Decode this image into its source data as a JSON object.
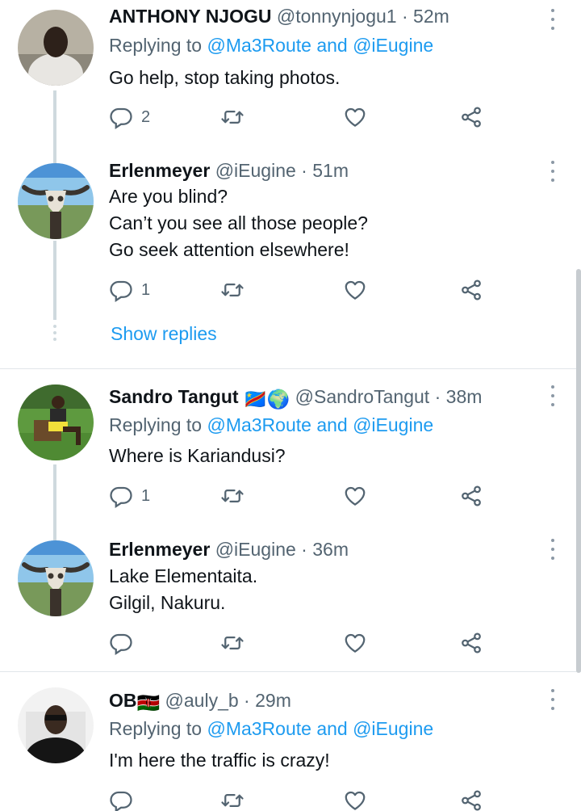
{
  "tweets": [
    {
      "name": "ANTHONY NJOGU",
      "flags": "",
      "handle": "@tonnynjogu1",
      "time": "52m",
      "replying_prefix": "Replying to",
      "replying_mentions": "@Ma3Route and @iEugine",
      "lines": [
        "Go help, stop taking photos."
      ],
      "reply_count": "2"
    },
    {
      "name": "Erlenmeyer",
      "flags": "",
      "handle": "@iEugine",
      "time": "51m",
      "lines": [
        "Are you blind?",
        "Can’t you see all those people?",
        "Go seek attention elsewhere!"
      ],
      "reply_count": "1"
    },
    {
      "name": "Sandro Tangut",
      "flags": "🇨🇩🌍",
      "handle": "@SandroTangut",
      "time": "38m",
      "replying_prefix": "Replying to",
      "replying_mentions": "@Ma3Route and @iEugine",
      "lines": [
        "Where is Kariandusi?"
      ],
      "reply_count": "1"
    },
    {
      "name": "Erlenmeyer",
      "flags": "",
      "handle": "@iEugine",
      "time": "36m",
      "lines": [
        "Lake Elementaita.",
        "Gilgil, Nakuru."
      ],
      "reply_count": ""
    },
    {
      "name": "OB",
      "flags": "🇰🇪",
      "handle": "@auly_b",
      "time": "29m",
      "replying_prefix": "Replying to",
      "replying_mentions": "@Ma3Route and @iEugine",
      "lines": [
        "I'm here the traffic is crazy!"
      ],
      "reply_count": ""
    }
  ],
  "show_replies_label": "Show replies",
  "separator": "·",
  "icons": {
    "reply": "reply-icon",
    "retweet": "retweet-icon",
    "like": "heart-icon",
    "share": "share-icon",
    "more": "more-vertical-icon"
  },
  "colors": {
    "link": "#1d9bf0",
    "text": "#0f1419",
    "secondary": "#536471"
  }
}
